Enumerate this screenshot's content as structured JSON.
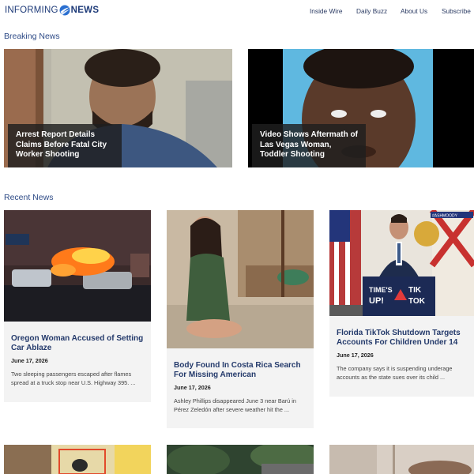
{
  "site": {
    "logo_part1": "INFORMING",
    "logo_part2": "NEWS",
    "brand_color": "#1d3a78"
  },
  "nav": {
    "items": [
      "Inside Wire",
      "Daily Buzz",
      "About Us",
      "Subscribe"
    ]
  },
  "breaking": {
    "title": "Breaking News",
    "cards": [
      {
        "headline": "Arrest Report Details Claims Before Fatal City Worker Shooting"
      },
      {
        "headline": "Video Shows Aftermath of Las Vegas Woman, Toddler Shooting"
      }
    ]
  },
  "recent": {
    "title": "Recent News",
    "cards": [
      {
        "headline": "Oregon Woman Accused of Setting Car Ablaze",
        "date": "June 17, 2026",
        "summary": "Two sleeping passengers escaped after flames spread at a truck stop near U.S. Highway 395. ..."
      },
      {
        "headline": "Body Found In Costa Rica Search For Missing American",
        "date": "June 17, 2026",
        "summary": "Ashley Phillips disappeared June 3 near Barú in Pérez Zeledón after severe weather hit the ..."
      },
      {
        "headline": "Florida TikTok Shutdown Targets Accounts For Children Under 14",
        "date": "June 17, 2026",
        "summary": "The company says it is suspending underage accounts as the state sues over its child ...",
        "image_sign_line1": "TIME'S",
        "image_sign_line2": "UP!",
        "image_sign_tik": "TIK",
        "image_sign_tok": "TOK",
        "image_credit": "#ASHMOODY"
      }
    ]
  }
}
